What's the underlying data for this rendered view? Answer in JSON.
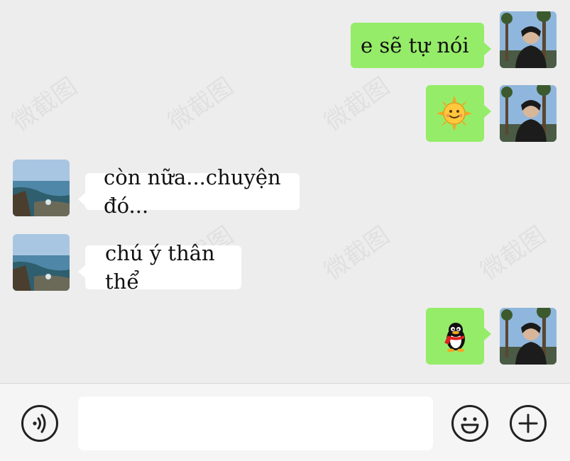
{
  "messages": [
    {
      "side": "out",
      "text": "e sẽ tự nói"
    },
    {
      "side": "out",
      "emoji": "sun-emoji"
    },
    {
      "side": "in",
      "text": "còn nữa...chuyện đó..."
    },
    {
      "side": "in",
      "text": "chú ý thân thể"
    },
    {
      "side": "out",
      "emoji": "qq-penguin-emoji"
    }
  ],
  "watermark": "微截图",
  "icons": {
    "voice": "voice-icon",
    "emoji": "emoji-icon",
    "more": "plus-icon"
  },
  "colors": {
    "out_bubble": "#95ec69",
    "in_bubble": "#ffffff",
    "background": "#ededed"
  }
}
